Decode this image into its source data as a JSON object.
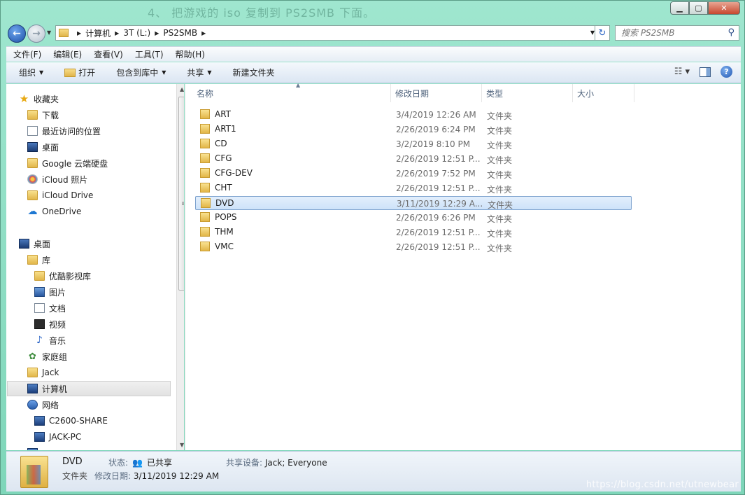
{
  "window": {
    "title": "4、 把游戏的 iso 复制到 PS2SMB 下面。",
    "minimize_icon": "minimize-icon",
    "maximize_icon": "maximize-icon",
    "close_icon": "close-icon"
  },
  "address": {
    "crumbs": [
      "计算机",
      "3T (L:)",
      "PS2SMB"
    ]
  },
  "search": {
    "placeholder": "搜索 PS2SMB"
  },
  "menu": [
    "文件(F)",
    "编辑(E)",
    "查看(V)",
    "工具(T)",
    "帮助(H)"
  ],
  "toolbar": {
    "organize": "组织",
    "open": "打开",
    "include": "包含到库中",
    "share": "共享",
    "new_folder": "新建文件夹"
  },
  "nav": {
    "favorites": "收藏夹",
    "downloads": "下载",
    "recent": "最近访问的位置",
    "desktop_fav": "桌面",
    "google": "Google 云端硬盘",
    "icloud_photos": "iCloud 照片",
    "icloud_drive": "iCloud Drive",
    "onedrive": "OneDrive",
    "desktop": "桌面",
    "library": "库",
    "youku": "优酷影视库",
    "pictures": "图片",
    "documents": "文档",
    "videos": "视频",
    "music": "音乐",
    "homegroup": "家庭组",
    "jack": "Jack",
    "computer": "计算机",
    "network": "网络",
    "c2600": "C2600-SHARE",
    "jackpc": "JACK-PC"
  },
  "columns": {
    "name": "名称",
    "modified": "修改日期",
    "type": "类型",
    "size": "大小"
  },
  "files": [
    {
      "name": "ART",
      "date": "3/4/2019 12:26 AM",
      "type": "文件夹"
    },
    {
      "name": "ART1",
      "date": "2/26/2019 6:24 PM",
      "type": "文件夹"
    },
    {
      "name": "CD",
      "date": "3/2/2019 8:10 PM",
      "type": "文件夹"
    },
    {
      "name": "CFG",
      "date": "2/26/2019 12:51 P...",
      "type": "文件夹"
    },
    {
      "name": "CFG-DEV",
      "date": "2/26/2019 7:52 PM",
      "type": "文件夹"
    },
    {
      "name": "CHT",
      "date": "2/26/2019 12:51 P...",
      "type": "文件夹"
    },
    {
      "name": "DVD",
      "date": "3/11/2019 12:29 A...",
      "type": "文件夹"
    },
    {
      "name": "POPS",
      "date": "2/26/2019 6:26 PM",
      "type": "文件夹"
    },
    {
      "name": "THM",
      "date": "2/26/2019 12:51 P...",
      "type": "文件夹"
    },
    {
      "name": "VMC",
      "date": "2/26/2019 12:51 P...",
      "type": "文件夹"
    }
  ],
  "selected_row": 6,
  "status": {
    "name": "DVD",
    "state_label": "状态:",
    "state_value": "已共享",
    "share_label": "共享设备:",
    "share_value": "Jack; Everyone",
    "type": "文件夹",
    "modified_label": "修改日期:",
    "modified_value": "3/11/2019 12:29 AM"
  },
  "watermark": "https://blog.csdn.net/utnewbear",
  "colors": {
    "frame": "#7ed6b9",
    "selection": "#cde2f9",
    "selection_border": "#7da2ce"
  }
}
